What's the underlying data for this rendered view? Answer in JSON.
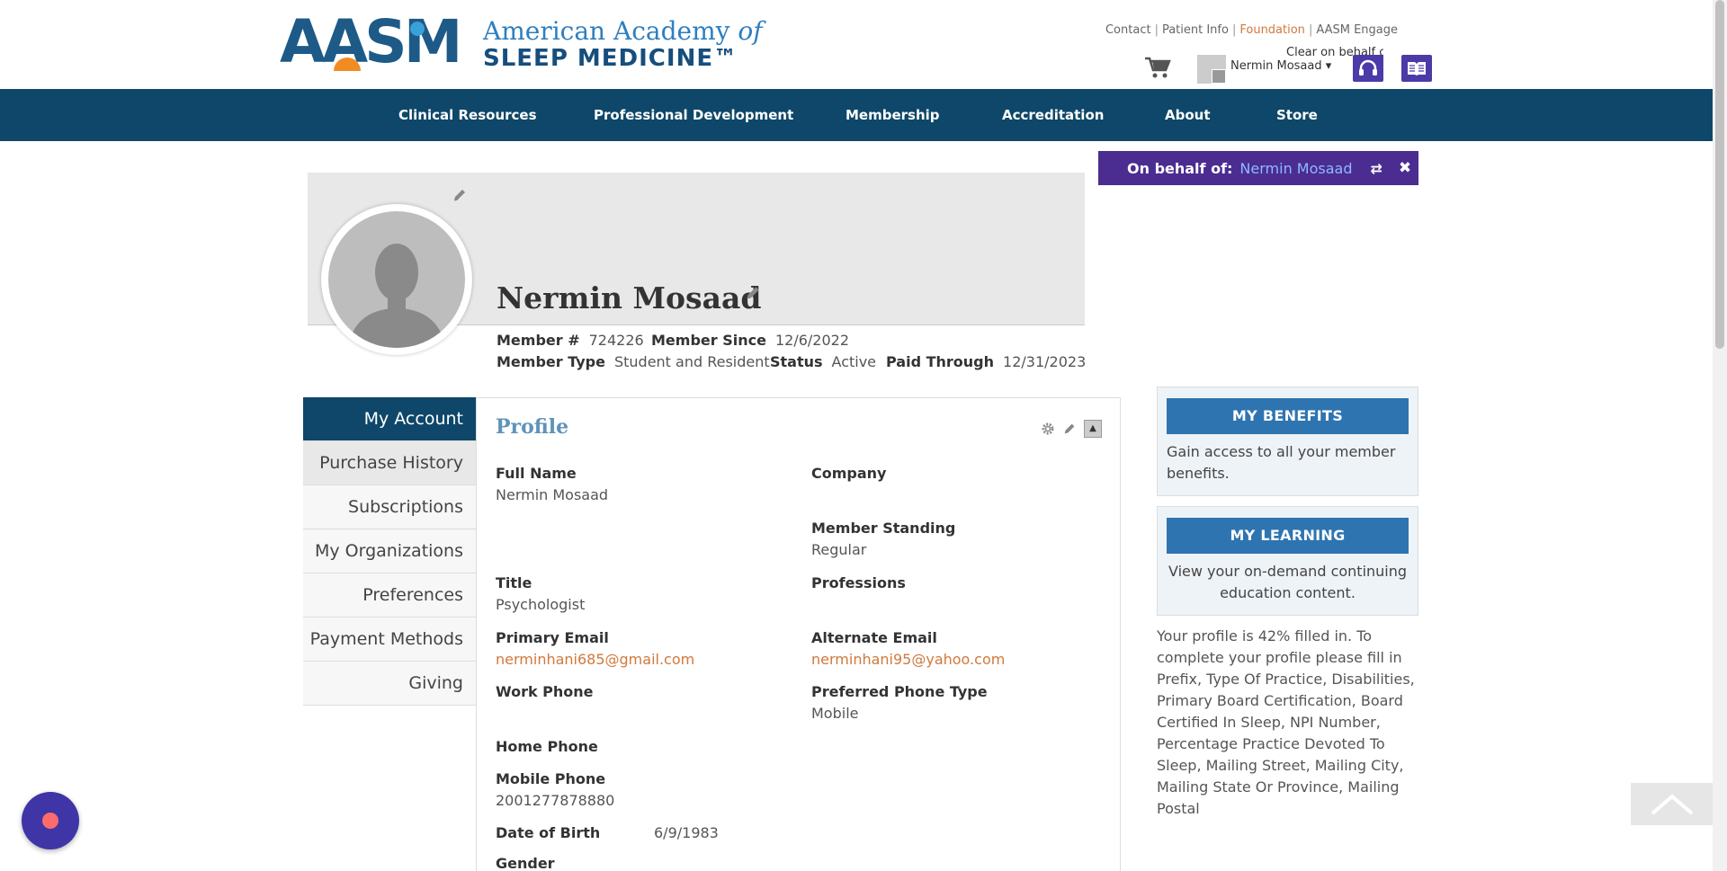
{
  "brand": {
    "mark": "AASM",
    "line1_main": "American Academy ",
    "line1_italic": "of",
    "line2": "SLEEP MEDICINE™"
  },
  "top_links": {
    "contact": "Contact",
    "patient_info": "Patient Info",
    "foundation": "Foundation",
    "engage": "AASM Engage",
    "separator": "|"
  },
  "user": {
    "name": "Nermin Mosaad",
    "caret": "▾",
    "clear_behalf": "Clear on behalf of"
  },
  "nav": [
    "Clinical Resources",
    "Professional Development",
    "Membership",
    "Accreditation",
    "About",
    "Store"
  ],
  "behalf": {
    "label": "On behalf of:",
    "name": "Nermin Mosaad",
    "swap_glyph": "⇄",
    "close_glyph": "✖"
  },
  "profile_header": {
    "name": "Nermin Mosaad",
    "member_no_label": "Member #",
    "member_no": "724226",
    "member_since_label": "Member Since",
    "member_since": "12/6/2022",
    "member_type_label": "Member Type",
    "member_type": "Student and Resident",
    "status_label": "Status",
    "status": "Active",
    "paid_through_label": "Paid Through",
    "paid_through": "12/31/2023"
  },
  "tabs": [
    "My Account",
    "Purchase History",
    "Subscriptions",
    "My Organizations",
    "Preferences",
    "Payment Methods",
    "Giving"
  ],
  "profile": {
    "title": "Profile",
    "collapse_glyph": "▲",
    "full_name_label": "Full Name",
    "full_name": "Nermin Mosaad",
    "company_label": "Company",
    "member_standing_label": "Member Standing",
    "member_standing": "Regular",
    "title_label": "Title",
    "title_value": "Psychologist",
    "professions_label": "Professions",
    "primary_email_label": "Primary Email",
    "primary_email": "nerminhani685@gmail.com",
    "alternate_email_label": "Alternate Email",
    "alternate_email": "nerminhani95@yahoo.com",
    "work_phone_label": "Work Phone",
    "preferred_phone_label": "Preferred Phone Type",
    "preferred_phone": "Mobile",
    "home_phone_label": "Home Phone",
    "mobile_phone_label": "Mobile Phone",
    "mobile_phone": "2001277878880",
    "dob_label": "Date of Birth",
    "dob": "6/9/1983",
    "gender_label": "Gender"
  },
  "sidebar": {
    "benefits_button": "MY BENEFITS",
    "benefits_text": "Gain access to all your member benefits.",
    "learning_button": "MY LEARNING",
    "learning_text": "View your on-demand continuing education content.",
    "profile_note": "Your profile is 42% filled in. To complete your profile please fill in Prefix, Type Of Practice, Disabilities, Primary Board Certification, Board Certified In Sleep, NPI Number, Percentage Practice Devoted To Sleep, Mailing Street, Mailing City, Mailing State Or Province, Mailing Postal"
  },
  "colors": {
    "nav_bg": "#0e4769",
    "behalf_bg": "#4b2c91",
    "accent_link": "#d0793c",
    "button_blue": "#2e74b0"
  }
}
